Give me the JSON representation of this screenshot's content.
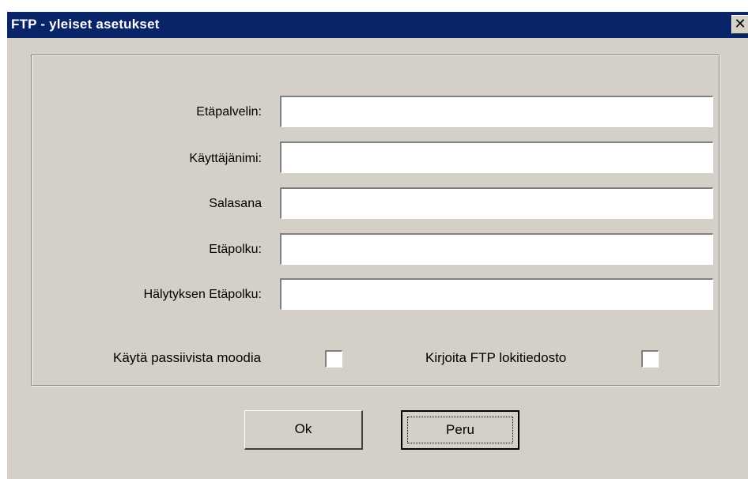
{
  "window": {
    "title": "FTP - yleiset asetukset",
    "close_glyph": "✕"
  },
  "form": {
    "fields": [
      {
        "label": "Etäpalvelin:",
        "value": ""
      },
      {
        "label": "Käyttäjänimi:",
        "value": ""
      },
      {
        "label": "Salasana",
        "value": ""
      },
      {
        "label": "Etäpolku:",
        "value": ""
      },
      {
        "label": "Hälytyksen Etäpolku:",
        "value": ""
      }
    ],
    "passive_mode": {
      "label": "Käytä passiivista moodia",
      "checked": false
    },
    "write_log": {
      "label": "Kirjoita FTP lokitiedosto",
      "checked": false
    }
  },
  "buttons": {
    "ok_label": "Ok",
    "cancel_label": "Peru"
  },
  "colors": {
    "titlebar": "#0a246a",
    "face": "#d4d0c8"
  }
}
